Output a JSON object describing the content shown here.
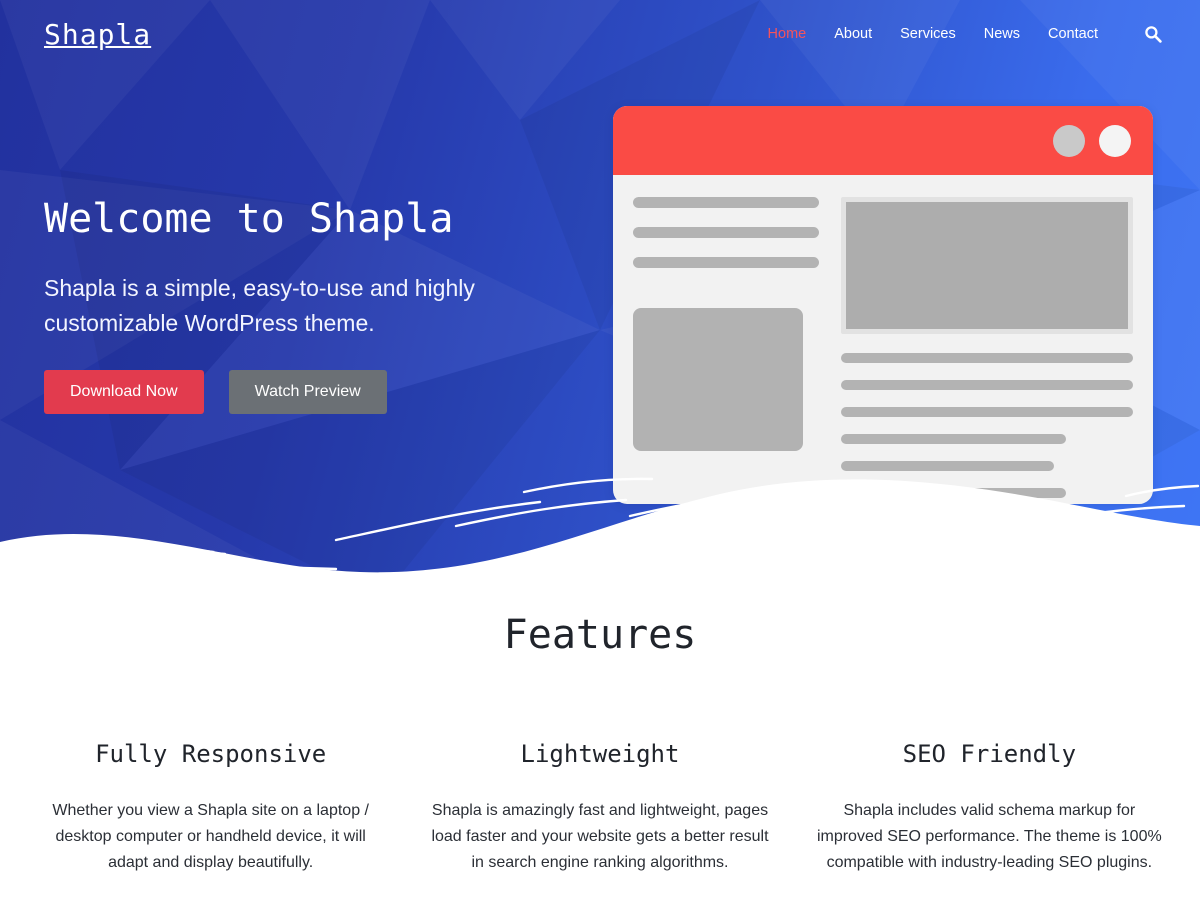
{
  "site": {
    "logo": "Shapla",
    "accent_red": "#e23b4e",
    "nav_active_color": "#f4535c",
    "hero_gradient_from": "#22319e",
    "hero_gradient_to": "#3f76f5",
    "mockup_bar_color": "#fa4b45"
  },
  "nav": {
    "items": [
      {
        "label": "Home",
        "active": true
      },
      {
        "label": "About",
        "active": false
      },
      {
        "label": "Services",
        "active": false
      },
      {
        "label": "News",
        "active": false
      },
      {
        "label": "Contact",
        "active": false
      }
    ],
    "search_icon": "search-icon"
  },
  "hero": {
    "title": "Welcome to Shapla",
    "subtitle": "Shapla is a simple, easy-to-use and highly customizable WordPress theme.",
    "primary_button": "Download Now",
    "secondary_button": "Watch Preview"
  },
  "mockup": {
    "dots": [
      "gray",
      "white"
    ],
    "left_bars": [
      100,
      100,
      100
    ],
    "right_lines": [
      100,
      100,
      100,
      77,
      73,
      77,
      84
    ]
  },
  "features": {
    "title": "Features",
    "items": [
      {
        "name": "Fully Responsive",
        "desc": "Whether you view a Shapla site on a laptop / desktop computer or handheld device, it will adapt and display beautifully."
      },
      {
        "name": "Lightweight",
        "desc": "Shapla is amazingly fast and lightweight, pages load faster and your website gets a better result in search engine ranking algorithms."
      },
      {
        "name": "SEO Friendly",
        "desc": "Shapla includes valid schema markup for improved SEO performance. The theme is 100% compatible with industry-leading SEO plugins."
      }
    ]
  }
}
